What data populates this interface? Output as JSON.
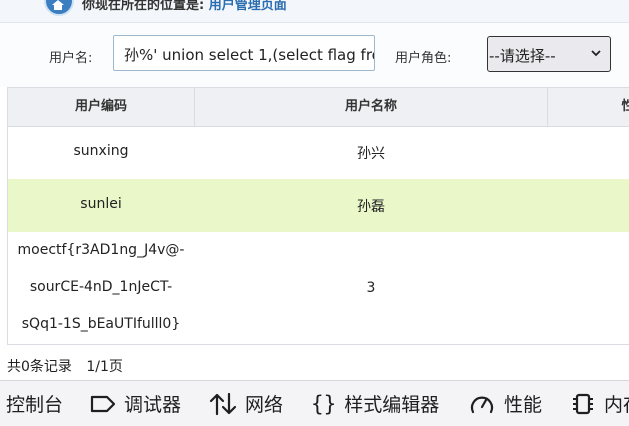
{
  "header": {
    "location_prefix": "你现在所在的位置是:",
    "location_current": "用户管理页面"
  },
  "search": {
    "username_label": "用户名:",
    "username_value": "孙%' union select 1,(select flag fro",
    "role_label": "用户角色:",
    "role_selected": "--请选择--"
  },
  "table": {
    "columns": [
      "用户编码",
      "用户名称",
      "性"
    ],
    "rows": [
      {
        "code": "sunxing",
        "name": "孙兴"
      },
      {
        "code": "sunlei",
        "name": "孙磊"
      },
      {
        "code_lines": [
          "moectf{r3AD1ng_J4v@-",
          "sourCE-4nD_1nJeCT-",
          "sQq1-1S_bEaUTIfulll0}"
        ],
        "name": "3"
      }
    ]
  },
  "pager": {
    "total": "共0条记录",
    "pages": "1/1页"
  },
  "devtools": {
    "tabs": [
      {
        "label": "控制台",
        "icon": "console-icon"
      },
      {
        "label": "调试器",
        "icon": "debugger-icon"
      },
      {
        "label": "网络",
        "icon": "network-icon"
      },
      {
        "label": "样式编辑器",
        "icon": "style-editor-icon"
      },
      {
        "label": "性能",
        "icon": "performance-icon"
      },
      {
        "label": "内存",
        "icon": "memory-icon"
      }
    ]
  }
}
